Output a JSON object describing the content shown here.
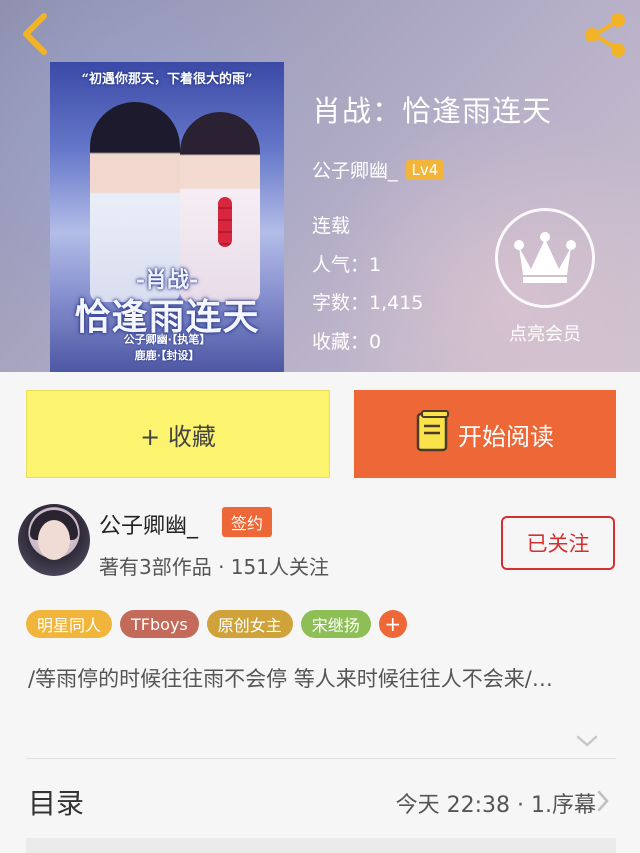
{
  "book": {
    "title": "肖战：恰逢雨连天",
    "author": "公子卿幽_",
    "level": "Lv4",
    "status": "连载",
    "stats": {
      "popularity": "人气：1",
      "words": "字数：1,415",
      "favorites": "收藏：0"
    }
  },
  "cover": {
    "tagline": "“初遇你那天，下着很大的雨”",
    "title_line1": "-肖战-",
    "title_line2": "恰逢雨连天",
    "credit_line1": "公子卿幽·【执笔】",
    "credit_line2": "鹿鹿·【封设】"
  },
  "member": {
    "label": "点亮会员"
  },
  "actions": {
    "favorite_label": "+ 收藏",
    "read_label": "开始阅读"
  },
  "author_card": {
    "name": "公子卿幽_",
    "badge": "签约",
    "meta": "著有3部作品 · 151人关注",
    "follow_label": "已关注"
  },
  "tags": [
    {
      "label": "明星同人",
      "color": "#f0b53a"
    },
    {
      "label": "TFboys",
      "color": "#c36a5a"
    },
    {
      "label": "原创女主",
      "color": "#cfa23a"
    },
    {
      "label": "宋继扬",
      "color": "#8dbf56"
    }
  ],
  "tag_more": "+",
  "description": "/等雨停的时候往往雨不会停   等人来时候往往人不会来/…",
  "toc": {
    "title": "目录",
    "latest": "今天 22:38 · 1.序幕"
  },
  "colors": {
    "accent_orange": "#ee6737",
    "favorite_yellow": "#fcf46f",
    "follow_red": "#d5302f",
    "level_gold": "#f3b43a"
  },
  "icons": {
    "back": "chevron-left-icon",
    "share": "share-icon",
    "crown": "crown-icon",
    "book": "book-icon",
    "expand": "chevron-down-icon",
    "toc_arrow": "chevron-right-icon"
  }
}
